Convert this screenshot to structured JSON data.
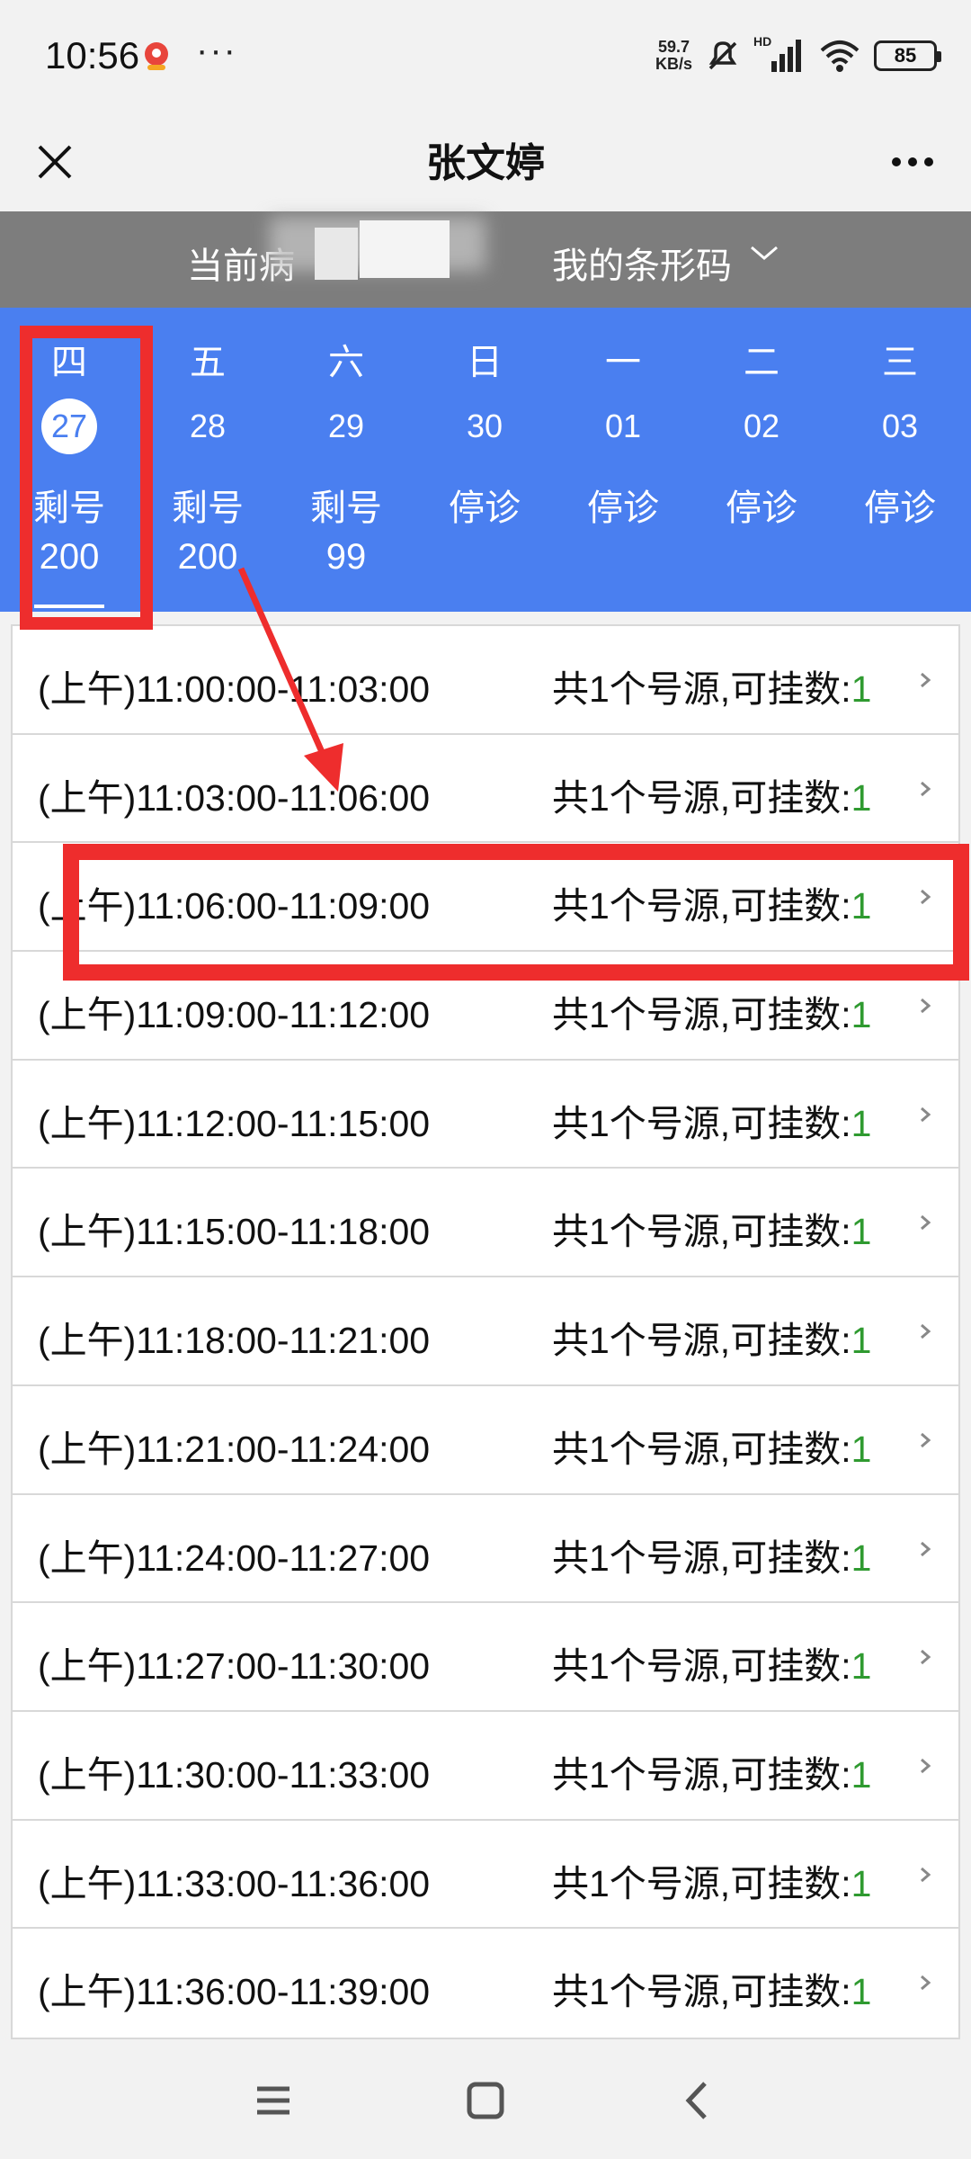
{
  "status_bar": {
    "time": "10:56",
    "more": "···",
    "net_speed_value": "59.7",
    "net_speed_unit": "KB/s",
    "network_label": "HD",
    "battery": "85"
  },
  "title_bar": {
    "title": "张文婷"
  },
  "header": {
    "patient_label": "当前病",
    "barcode_label": "我的条形码"
  },
  "days": [
    {
      "weekday": "四",
      "date": "27",
      "status": "剩号",
      "count": "200",
      "selected": true
    },
    {
      "weekday": "五",
      "date": "28",
      "status": "剩号",
      "count": "200",
      "selected": false
    },
    {
      "weekday": "六",
      "date": "29",
      "status": "剩号",
      "count": "99",
      "selected": false
    },
    {
      "weekday": "日",
      "date": "30",
      "status": "停诊",
      "count": "",
      "selected": false
    },
    {
      "weekday": "一",
      "date": "01",
      "status": "停诊",
      "count": "",
      "selected": false
    },
    {
      "weekday": "二",
      "date": "02",
      "status": "停诊",
      "count": "",
      "selected": false
    },
    {
      "weekday": "三",
      "date": "03",
      "status": "停诊",
      "count": "",
      "selected": false
    }
  ],
  "slots": [
    {
      "time": "(上午)11:00:00-11:03:00",
      "avail_label": "共1个号源,可挂数:",
      "count": "1"
    },
    {
      "time": "(上午)11:03:00-11:06:00",
      "avail_label": "共1个号源,可挂数:",
      "count": "1"
    },
    {
      "time": "(上午)11:06:00-11:09:00",
      "avail_label": "共1个号源,可挂数:",
      "count": "1"
    },
    {
      "time": "(上午)11:09:00-11:12:00",
      "avail_label": "共1个号源,可挂数:",
      "count": "1"
    },
    {
      "time": "(上午)11:12:00-11:15:00",
      "avail_label": "共1个号源,可挂数:",
      "count": "1"
    },
    {
      "time": "(上午)11:15:00-11:18:00",
      "avail_label": "共1个号源,可挂数:",
      "count": "1"
    },
    {
      "time": "(上午)11:18:00-11:21:00",
      "avail_label": "共1个号源,可挂数:",
      "count": "1"
    },
    {
      "time": "(上午)11:21:00-11:24:00",
      "avail_label": "共1个号源,可挂数:",
      "count": "1"
    },
    {
      "time": "(上午)11:24:00-11:27:00",
      "avail_label": "共1个号源,可挂数:",
      "count": "1"
    },
    {
      "time": "(上午)11:27:00-11:30:00",
      "avail_label": "共1个号源,可挂数:",
      "count": "1"
    },
    {
      "time": "(上午)11:30:00-11:33:00",
      "avail_label": "共1个号源,可挂数:",
      "count": "1"
    },
    {
      "time": "(上午)11:33:00-11:36:00",
      "avail_label": "共1个号源,可挂数:",
      "count": "1"
    },
    {
      "time": "(上午)11:36:00-11:39:00",
      "avail_label": "共1个号源,可挂数:",
      "count": "1"
    }
  ],
  "colors": {
    "accent_blue": "#4a7ff0",
    "header_gray": "#7d7d7d",
    "annotation_red": "#ee2d2d",
    "count_green": "#2f9a30"
  },
  "icons": {
    "close": "close-icon",
    "menu": "more-dots-icon",
    "chevron": "chevron-down-icon",
    "row_arrow": "chevron-right-icon",
    "nav_menu": "menu-icon",
    "nav_home": "home-icon",
    "nav_back": "back-icon"
  }
}
